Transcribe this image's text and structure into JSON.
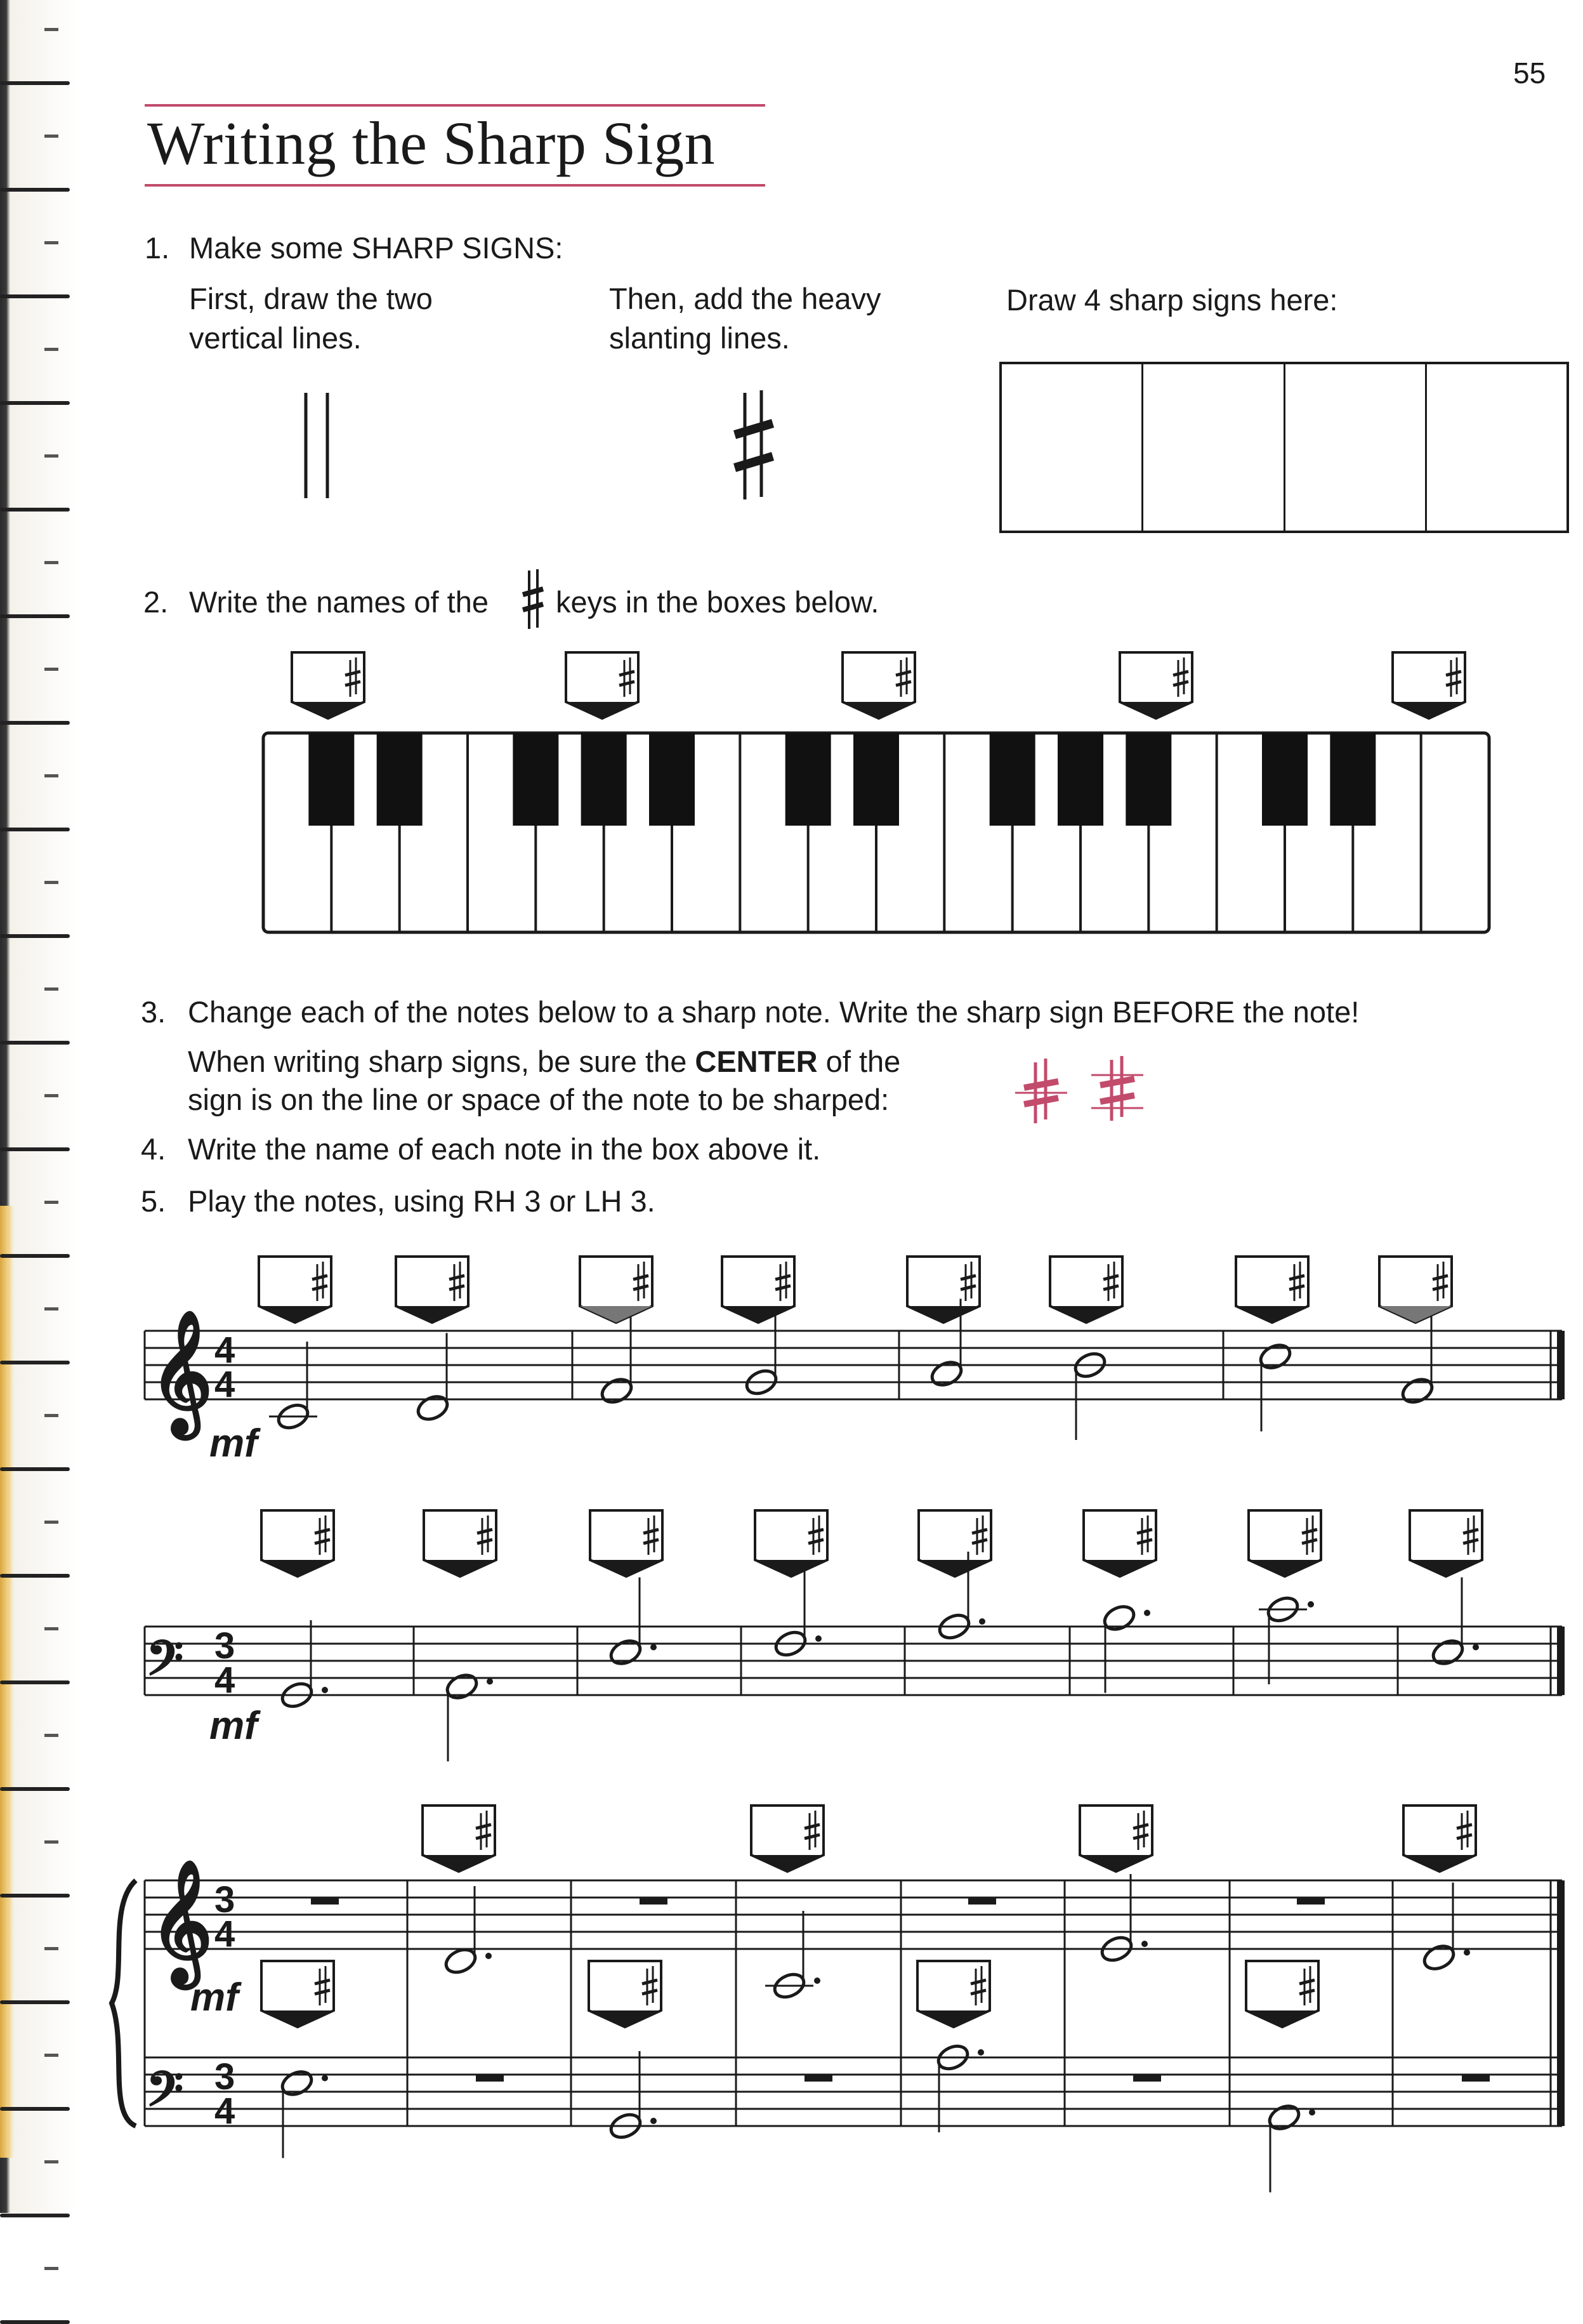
{
  "page": {
    "number": "55",
    "title": "Writing the Sharp Sign"
  },
  "section1": {
    "num": "1.",
    "heading": "Make some SHARP SIGNS:",
    "col1_line1": "First, draw the two",
    "col1_line2": "vertical lines.",
    "col2_line1": "Then, add the heavy",
    "col2_line2": "slanting lines.",
    "col3": "Draw 4 sharp signs here:",
    "drawing_boxes": 4
  },
  "section2": {
    "num": "2.",
    "text_before": "Write the names of the",
    "text_after": "keys in the boxes below.",
    "answer_boxes": 5
  },
  "section3": {
    "num": "3.",
    "text": "Change each of the notes below to a sharp note.  Write the sharp sign BEFORE the note!",
    "tip_line1_a": "When writing sharp signs, be sure the ",
    "tip_line1_bold": "CENTER",
    "tip_line1_b": " of the",
    "tip_line2": "sign is on the line or space of the note to be sharped:"
  },
  "section4": {
    "num": "4.",
    "text": "Write the name of each note in the box above it."
  },
  "section5": {
    "num": "5.",
    "text": "Play the notes, using RH 3 or LH 3."
  },
  "symbols": {
    "sharp": "♯",
    "treble_clef": "𝄞",
    "bass_clef": "𝄢"
  },
  "staff1": {
    "clef": "treble",
    "time_top": "4",
    "time_bottom": "4",
    "dynamic": "mf"
  },
  "staff2": {
    "clef": "bass",
    "time_top": "3",
    "time_bottom": "4",
    "dynamic": "mf"
  },
  "staff3": {
    "clefs": [
      "treble",
      "bass"
    ],
    "time_top": "3",
    "time_bottom": "4",
    "dynamic": "mf"
  },
  "colors": {
    "accent": "#c24b6b",
    "ink": "#1a1a1a"
  }
}
